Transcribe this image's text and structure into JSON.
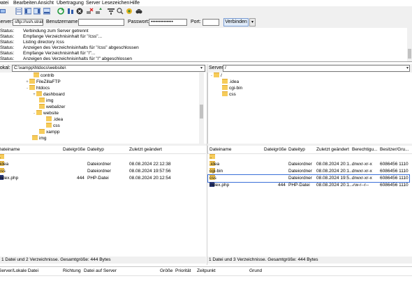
{
  "menu": [
    "Datei",
    "Bearbeiten",
    "Ansicht",
    "Übertragung",
    "Server",
    "Lesezeichen",
    "Hilfe"
  ],
  "toolbar": {
    "icons": [
      "site-manager-icon",
      "toggle-log-icon",
      "toggle-local-tree-icon",
      "toggle-remote-tree-icon",
      "toggle-queue-icon",
      "refresh-icon",
      "process-queue-icon",
      "cancel-icon",
      "disconnect-icon",
      "reconnect-icon",
      "filter-icon",
      "compare-icon",
      "sync-browse-icon",
      "search-icon"
    ]
  },
  "quickconnect": {
    "server_label": "Server:",
    "server_value": "sftp://ssh.strato.de",
    "user_label": "Benutzername:",
    "user_value": "",
    "password_label": "Passwort:",
    "password_value": "••••••••••••••",
    "port_label": "Port:",
    "port_value": "",
    "connect_label": "Verbinden"
  },
  "log": [
    {
      "k": "Status:",
      "m": "Verbindung zum Server getrennt"
    },
    {
      "k": "Status:",
      "m": "Empfange Verzeichnisinhalt für \"/css\"..."
    },
    {
      "k": "Status:",
      "m": "Listing directory /css"
    },
    {
      "k": "Status:",
      "m": "Anzeigen des Verzeichnisinhalts für \"/css\" abgeschlossen"
    },
    {
      "k": "Status:",
      "m": "Empfange Verzeichnisinhalt für \"/\"..."
    },
    {
      "k": "Status:",
      "m": "Anzeigen des Verzeichnisinhalts für \"/\" abgeschlossen"
    }
  ],
  "local": {
    "path_label": "Lokal:",
    "path_value": "C:\\xampp\\htdocs\\website\\",
    "tree": [
      {
        "label": "contrib",
        "level": 4,
        "exp": ""
      },
      {
        "label": "FileZillaFTP",
        "level": 3,
        "exp": "+"
      },
      {
        "label": "htdocs",
        "level": 3,
        "exp": "-"
      },
      {
        "label": "dashboard",
        "level": 4,
        "exp": "+"
      },
      {
        "label": "img",
        "level": 4,
        "exp": ""
      },
      {
        "label": "webalizer",
        "level": 4,
        "exp": ""
      },
      {
        "label": "website",
        "level": 4,
        "exp": "-"
      },
      {
        "label": ".idea",
        "level": 5,
        "exp": ""
      },
      {
        "label": "css",
        "level": 5,
        "exp": ""
      },
      {
        "label": "xampp",
        "level": 4,
        "exp": ""
      },
      {
        "label": "img",
        "level": 3,
        "exp": ""
      }
    ],
    "columns": [
      "Dateiname",
      "Dateigröße",
      "Dateityp",
      "Zuletzt geändert"
    ],
    "rows": [
      {
        "name": "..",
        "size": "",
        "type": "",
        "date": "",
        "icon": "folder"
      },
      {
        "name": ".idea",
        "size": "",
        "type": "Dateiordner",
        "date": "08.08.2024 22:12:38",
        "icon": "folder"
      },
      {
        "name": "css",
        "size": "",
        "type": "Dateiordner",
        "date": "08.08.2024 19:57:56",
        "icon": "folder"
      },
      {
        "name": "index.php",
        "size": "444",
        "type": "PHP-Datei",
        "date": "08.08.2024 20:12:54",
        "icon": "php"
      }
    ],
    "status": "1 Datei und 2 Verzeichnisse. Gesamtgröße: 444 Bytes"
  },
  "remote": {
    "path_label": "Server:",
    "path_value": "/",
    "tree": [
      {
        "label": "/",
        "level": 0,
        "exp": "-"
      },
      {
        "label": ".idea",
        "level": 1,
        "exp": ""
      },
      {
        "label": "cgi-bin",
        "level": 1,
        "exp": ""
      },
      {
        "label": "css",
        "level": 1,
        "exp": ""
      }
    ],
    "columns": [
      "Dateiname",
      "Dateigröße",
      "Dateityp",
      "Zuletzt geändert",
      "Berechtigu...",
      "Besitzer/Gru..."
    ],
    "rows": [
      {
        "name": "..",
        "size": "",
        "type": "",
        "date": "",
        "perm": "",
        "owner": "",
        "icon": "folder"
      },
      {
        "name": ".idea",
        "size": "",
        "type": "Dateiordner",
        "date": "08.08.2024 20:1...",
        "perm": "drwxr-xr-x",
        "owner": "6086456 1110",
        "icon": "folder"
      },
      {
        "name": "cgi-bin",
        "size": "",
        "type": "Dateiordner",
        "date": "08.08.2024 20:1...",
        "perm": "drwxr-xr-x",
        "owner": "6086456 1110",
        "icon": "folder"
      },
      {
        "name": "css",
        "size": "",
        "type": "Dateiordner",
        "date": "08.08.2024 19:5...",
        "perm": "drwxr-xr-x",
        "owner": "6086456 1110",
        "icon": "folder"
      },
      {
        "name": "index.php",
        "size": "444",
        "type": "PHP-Datei",
        "date": "08.08.2024 20:1...",
        "perm": "-rw-r--r--",
        "owner": "6086456 1110",
        "icon": "php"
      }
    ],
    "status": "1 Datei und 3 Verzeichnisse. Gesamtgröße: 444 Bytes"
  },
  "queue": {
    "columns": [
      "Server/Lokale Datei",
      "Richtung",
      "Datei auf Server",
      "Größe",
      "Priorität",
      "Zeitpunkt",
      "Grund"
    ]
  }
}
